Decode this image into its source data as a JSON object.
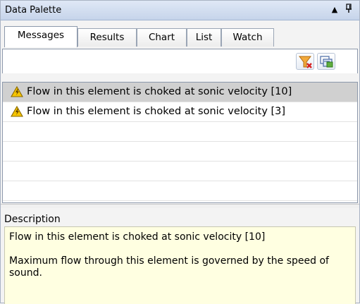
{
  "window": {
    "title": "Data Palette",
    "menu_glyph": "▲",
    "pin_glyph": "ꟷ"
  },
  "tabs": [
    {
      "label": "Messages",
      "active": true
    },
    {
      "label": "Results",
      "active": false
    },
    {
      "label": "Chart",
      "active": false
    },
    {
      "label": "List",
      "active": false
    },
    {
      "label": "Watch",
      "active": false
    }
  ],
  "toolbar": {
    "buttons": [
      {
        "name": "clear-filter-button",
        "icon": "funnel-clear-icon"
      },
      {
        "name": "export-button",
        "icon": "export-icon"
      }
    ]
  },
  "messages": [
    {
      "text": "Flow in this element is choked at sonic velocity [10]",
      "icon": "warning-icon",
      "selected": true
    },
    {
      "text": "Flow in this element is choked at sonic velocity [3]",
      "icon": "warning-icon",
      "selected": false
    }
  ],
  "description": {
    "label": "Description",
    "title": "Flow in this element is choked at sonic velocity [10]",
    "body": "Maximum flow through this element is governed by the speed of sound."
  },
  "colors": {
    "warning_fill": "#f5c400",
    "selected_row": "#d0d0d0",
    "description_bg": "#ffffe1"
  }
}
